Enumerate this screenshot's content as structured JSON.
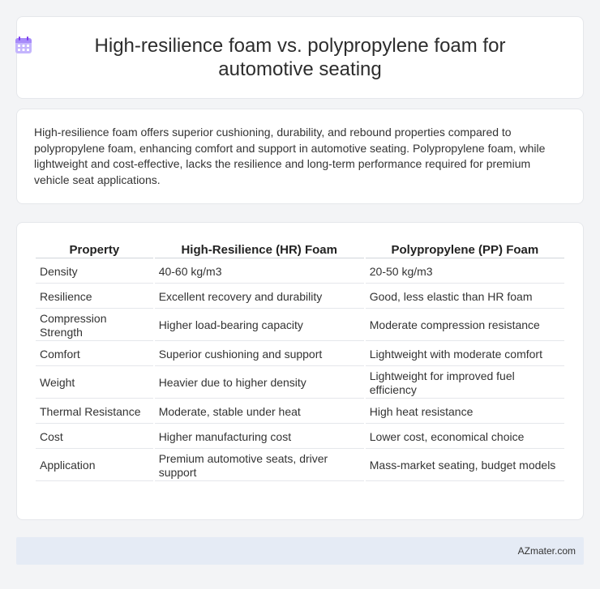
{
  "header": {
    "icon": "calendar-icon",
    "title": "High-resilience foam vs. polypropylene foam for automotive seating"
  },
  "summary": {
    "text": "High-resilience foam offers superior cushioning, durability, and rebound properties compared to polypropylene foam, enhancing comfort and support in automotive seating. Polypropylene foam, while lightweight and cost-effective, lacks the resilience and long-term performance required for premium vehicle seat applications."
  },
  "table": {
    "headers": [
      "Property",
      "High-Resilience (HR) Foam",
      "Polypropylene (PP) Foam"
    ],
    "rows": [
      [
        "Density",
        "40-60 kg/m3",
        "20-50 kg/m3"
      ],
      [
        "Resilience",
        "Excellent recovery and durability",
        "Good, less elastic than HR foam"
      ],
      [
        "Compression Strength",
        "Higher load-bearing capacity",
        "Moderate compression resistance"
      ],
      [
        "Comfort",
        "Superior cushioning and support",
        "Lightweight with moderate comfort"
      ],
      [
        "Weight",
        "Heavier due to higher density",
        "Lightweight for improved fuel efficiency"
      ],
      [
        "Thermal Resistance",
        "Moderate, stable under heat",
        "High heat resistance"
      ],
      [
        "Cost",
        "Higher manufacturing cost",
        "Lower cost, economical choice"
      ],
      [
        "Application",
        "Premium automotive seats, driver support",
        "Mass-market seating, budget models"
      ]
    ]
  },
  "footer": {
    "brand": "AZmater.com"
  }
}
